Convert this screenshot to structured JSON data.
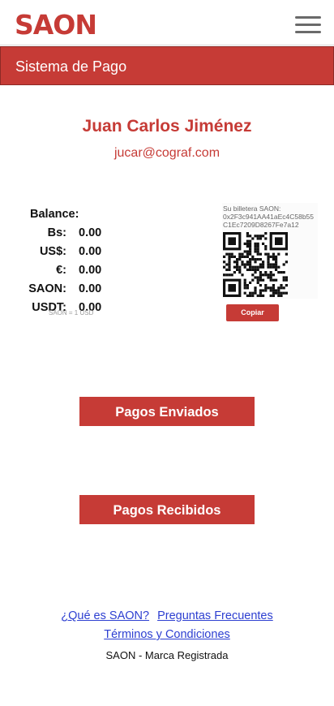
{
  "header": {
    "logo_text": "SAON",
    "menu_icon": "hamburger-menu-icon"
  },
  "section": {
    "title": "Sistema de Pago"
  },
  "user": {
    "name": "Juan Carlos Jiménez",
    "email": "jucar@cograf.com"
  },
  "balance": {
    "title": "Balance:",
    "rows": [
      {
        "label": "Bs:",
        "value": "0.00"
      },
      {
        "label": "US$:",
        "value": "0.00"
      },
      {
        "label": "€:",
        "value": "0.00"
      },
      {
        "label": "SAON:",
        "value": "0.00"
      },
      {
        "label": "USDT:",
        "value": "0.00"
      }
    ],
    "rate_note": "SAON = 1 USD"
  },
  "wallet": {
    "label": "Su billetera SAON:",
    "address_line1": "0x2F3c941AA41aEc4C58b55",
    "address_line2": "C1Ec7209D8267Fe7a12",
    "copy_label": "Copiar",
    "qr_icon": "qr-code-icon"
  },
  "actions": {
    "sent_label": "Pagos Enviados",
    "received_label": "Pagos Recibidos"
  },
  "footer": {
    "link_about": "¿Qué es SAON?",
    "link_faq": "Preguntas Frecuentes",
    "link_terms": "Términos y Condiciones",
    "brand": "SAON - Marca Registrada"
  },
  "colors": {
    "accent": "#c63b36",
    "link": "#2d3fd1",
    "text": "#111111"
  }
}
